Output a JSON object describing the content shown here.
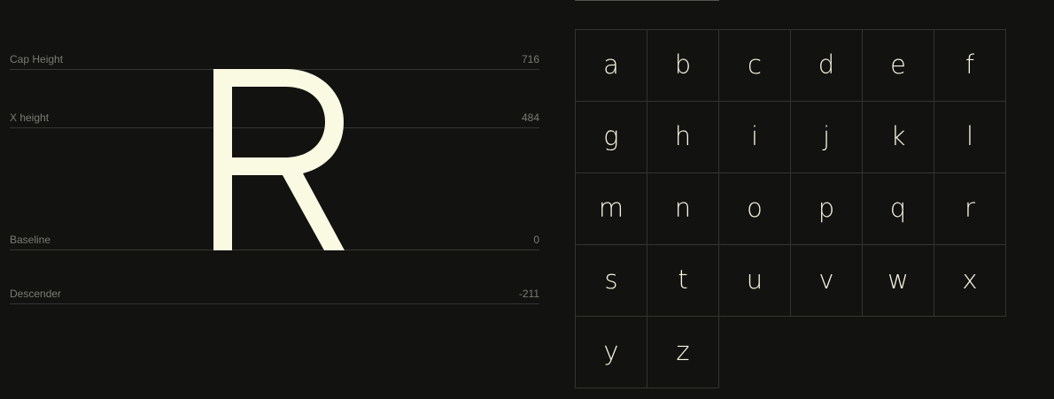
{
  "metrics": {
    "cap_height": {
      "label": "Cap Height",
      "value": "716"
    },
    "x_height": {
      "label": "X height",
      "value": "484"
    },
    "baseline": {
      "label": "Baseline",
      "value": "0"
    },
    "descender": {
      "label": "Descender",
      "value": "-211"
    }
  },
  "specimen": {
    "glyph": "R",
    "color": "#fafae3"
  },
  "glyphs": [
    "a",
    "b",
    "c",
    "d",
    "e",
    "f",
    "g",
    "h",
    "i",
    "j",
    "k",
    "l",
    "m",
    "n",
    "o",
    "p",
    "q",
    "r",
    "s",
    "t",
    "u",
    "v",
    "w",
    "x",
    "y",
    "z"
  ],
  "colors": {
    "background": "#121210",
    "glyph": "#f7f5df",
    "label": "#7b7b74",
    "rule": "#363633"
  }
}
